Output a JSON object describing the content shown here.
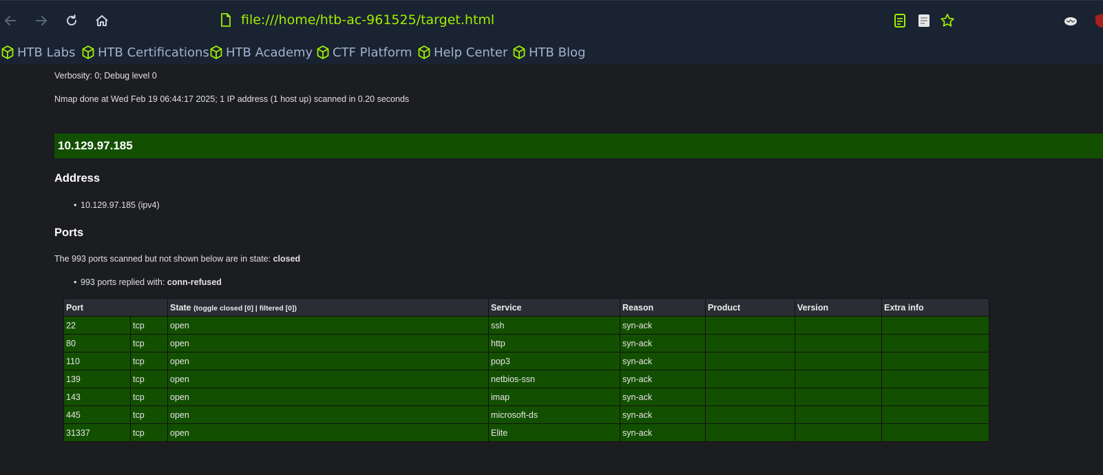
{
  "browser": {
    "url": "file:///home/htb-ac-961525/target.html",
    "bookmarks": [
      "HTB Labs",
      "HTB Certifications",
      "HTB Academy",
      "CTF Platform",
      "Help Center",
      "HTB Blog"
    ],
    "accent_color": "#9fef00",
    "bookmark_color": "#a4b1cd"
  },
  "report": {
    "verbosity_line": "Verbosity: 0; Debug level 0",
    "done_line": "Nmap done at Wed Feb 19 06:44:17 2025; 1 IP address (1 host up) scanned in 0.20 seconds",
    "host": "10.129.97.185",
    "address_heading": "Address",
    "address_item": "10.129.97.185 (ipv4)",
    "ports_heading": "Ports",
    "closed_prefix": "The 993 ports scanned but not shown below are in state: ",
    "closed_state": "closed",
    "replied_prefix": "993 ports replied with: ",
    "replied_reason": "conn-refused",
    "host_bar_color": "#134f00"
  },
  "table": {
    "headers": {
      "port": "Port",
      "state": "State",
      "toggle": "(toggle closed [0] | filtered [0])",
      "service": "Service",
      "reason": "Reason",
      "product": "Product",
      "version": "Version",
      "extra": "Extra info"
    },
    "rows": [
      {
        "port": "22",
        "proto": "tcp",
        "state": "open",
        "service": "ssh",
        "reason": "syn-ack",
        "product": "",
        "version": "",
        "extra": ""
      },
      {
        "port": "80",
        "proto": "tcp",
        "state": "open",
        "service": "http",
        "reason": "syn-ack",
        "product": "",
        "version": "",
        "extra": ""
      },
      {
        "port": "110",
        "proto": "tcp",
        "state": "open",
        "service": "pop3",
        "reason": "syn-ack",
        "product": "",
        "version": "",
        "extra": ""
      },
      {
        "port": "139",
        "proto": "tcp",
        "state": "open",
        "service": "netbios-ssn",
        "reason": "syn-ack",
        "product": "",
        "version": "",
        "extra": ""
      },
      {
        "port": "143",
        "proto": "tcp",
        "state": "open",
        "service": "imap",
        "reason": "syn-ack",
        "product": "",
        "version": "",
        "extra": ""
      },
      {
        "port": "445",
        "proto": "tcp",
        "state": "open",
        "service": "microsoft-ds",
        "reason": "syn-ack",
        "product": "",
        "version": "",
        "extra": ""
      },
      {
        "port": "31337",
        "proto": "tcp",
        "state": "open",
        "service": "Elite",
        "reason": "syn-ack",
        "product": "",
        "version": "",
        "extra": ""
      }
    ]
  }
}
